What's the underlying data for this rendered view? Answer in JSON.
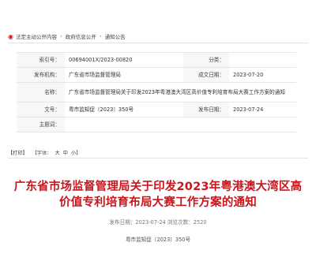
{
  "breadcrumb": {
    "items": [
      "法定主动公开内容",
      "政府信息公开",
      "通知公告"
    ],
    "separator": "›"
  },
  "meta": {
    "index_label": "索引号：",
    "index_value": "00694001X/2023-00820",
    "category_label": "分类：",
    "category_value": "",
    "issuer_label": "发布机构：",
    "issuer_value": "广东省市场监督管理局",
    "created_label": "成文日期：",
    "created_value": "2023-07-20",
    "name_label": "名称：",
    "name_value": "广东省市场监督管理局关于印发2023年粤港澳大湾区高价值专利培育布局大赛工作方案的通知",
    "docno_label": "文号：",
    "docno_value": "粤市监知促〔2023〕350号",
    "published_label": "发布日期：",
    "published_value": "2023-07-24",
    "subject_label": "主题词：",
    "subject_value": ""
  },
  "toolbar": {
    "print": "【打印】",
    "font_prefix": "【字体：",
    "size_large": "大",
    "size_medium": "中",
    "size_small": "小",
    "font_suffix": "】"
  },
  "article": {
    "title": "广东省市场监督管理局关于印发2023年粤港澳大湾区高价值专利培育布局大赛工作方案的通知",
    "publish_info": "发布日期：2023-07-24   浏览次数：2520",
    "doc_number": "粤市监知促〔2023〕350号"
  },
  "colors": {
    "title_red": "#c8161d",
    "label_bg": "#f7f7f7"
  }
}
